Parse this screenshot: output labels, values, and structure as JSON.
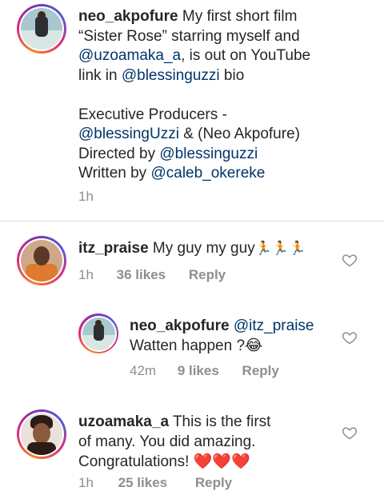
{
  "caption": {
    "username": "neo_akpofure",
    "line1_text": " My first short film",
    "line2_text": "“Sister Rose” starring myself and",
    "line3_mention": "@uzoamaka_a",
    "line3_text": ", is out on YouTube",
    "line4_text": "link in ",
    "line4_mention": "@blessinguzzi",
    "line4_after": " bio",
    "line5_text": "Executive Producers -",
    "line6_mention": "@blessingUzzi",
    "line6_text": " & (Neo Akpofure)",
    "line7_text": "Directed by ",
    "line7_mention": "@blessinguzzi",
    "line8_text": "Written by ",
    "line8_mention": "@caleb_okereke",
    "time": "1h"
  },
  "comments": [
    {
      "username": "itz_praise",
      "text": " My guy my guy",
      "emoji": "🏃🏃🏃",
      "time": "1h",
      "likes": "36 likes",
      "reply": "Reply"
    },
    {
      "username": "neo_akpofure",
      "mention": "@itz_praise",
      "line2": "Watten happen ?😂",
      "time": "42m",
      "likes": "9 likes",
      "reply": "Reply"
    },
    {
      "username": "uzoamaka_a",
      "line1": " This is the first",
      "line2": "of many. You did amazing.",
      "line3": "Congratulations! ",
      "hearts": "❤️❤️❤️",
      "time": "1h",
      "likes": "25 likes",
      "reply": "Reply"
    }
  ],
  "colors": {
    "mention": "#003569",
    "meta": "#8e8e8e",
    "running_figure": "#3fa34d",
    "heart": "#e0302f"
  }
}
